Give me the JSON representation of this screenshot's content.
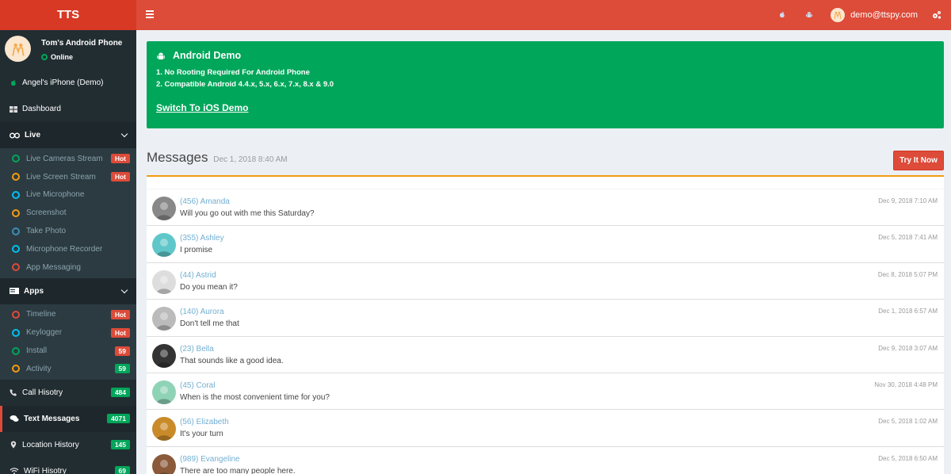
{
  "header": {
    "logo": "TTS",
    "user_email": "demo@ttspy.com",
    "icons": [
      "apple-icon",
      "android-icon",
      "cogs-icon"
    ]
  },
  "sidebar": {
    "device_name": "Tom's Android Phone",
    "device_status": "Online",
    "other_device": "Angel's iPhone (Demo)",
    "dashboard": "Dashboard",
    "live": {
      "label": "Live",
      "items": [
        {
          "label": "Live Cameras Stream",
          "color": "#00a65a",
          "badge": "Hot",
          "badge_color": "red"
        },
        {
          "label": "Live Screen Stream",
          "color": "#f39c12",
          "badge": "Hot",
          "badge_color": "red"
        },
        {
          "label": "Live Microphone",
          "color": "#00c0ef",
          "badge": null
        },
        {
          "label": "Screenshot",
          "color": "#f39c12",
          "badge": null
        },
        {
          "label": "Take Photo",
          "color": "#3c8dbc",
          "badge": null
        },
        {
          "label": "Microphone Recorder",
          "color": "#00c0ef",
          "badge": null
        },
        {
          "label": "App Messaging",
          "color": "#dd4b39",
          "badge": null
        }
      ]
    },
    "apps": {
      "label": "Apps",
      "items": [
        {
          "label": "Timeline",
          "color": "#dd4b39",
          "badge": "Hot",
          "badge_color": "red"
        },
        {
          "label": "Keylogger",
          "color": "#00c0ef",
          "badge": "Hot",
          "badge_color": "red"
        },
        {
          "label": "Install",
          "color": "#00a65a",
          "badge": "59",
          "badge_color": "red"
        },
        {
          "label": "Activity",
          "color": "#f39c12",
          "badge": "59",
          "badge_color": "green"
        }
      ]
    },
    "call_history": {
      "label": "Call Hisotry",
      "badge": "484"
    },
    "text_messages": {
      "label": "Text Messages",
      "badge": "4071"
    },
    "location_history": {
      "label": "Location History",
      "badge": "145"
    },
    "wifi_history": {
      "label": "WiFi Hisotry",
      "badge": "69"
    }
  },
  "demo": {
    "title": "Android Demo",
    "line1": "1. No Rooting Required For Android Phone",
    "line2": "2. Compatible Android 4.4.x, 5.x, 6.x, 7.x, 8.x & 9.0",
    "link": "Switch To iOS Demo"
  },
  "messages": {
    "title": "Messages",
    "subtitle": "Dec 1, 2018 8:40 AM",
    "try_button": "Try It Now",
    "list": [
      {
        "name": "(456) Amanda",
        "text": "Will you go out with me this Saturday?",
        "time": "Dec 9, 2018 7:10 AM",
        "avatar_color": "#888"
      },
      {
        "name": "(355) Ashley",
        "text": "I promise",
        "time": "Dec 5, 2018 7:41 AM",
        "avatar_color": "#5fc7c9"
      },
      {
        "name": "(44) Astrid",
        "text": "Do you mean it?",
        "time": "Dec 8, 2018 5:07 PM",
        "avatar_color": "#ddd"
      },
      {
        "name": "(140) Aurora",
        "text": "Don't tell me that",
        "time": "Dec 1, 2018 6:57 AM",
        "avatar_color": "#bbb"
      },
      {
        "name": "(23) Bella",
        "text": "That sounds like a good idea.",
        "time": "Dec 9, 2018 3:07 AM",
        "avatar_color": "#333"
      },
      {
        "name": "(45) Coral",
        "text": "When is the most convenient time for you?",
        "time": "Nov 30, 2018 4:48 PM",
        "avatar_color": "#8fd3b6"
      },
      {
        "name": "(56) Elizabeth",
        "text": "It's your turn",
        "time": "Dec 5, 2018 1:02 AM",
        "avatar_color": "#c98a2a"
      },
      {
        "name": "(989) Evangeline",
        "text": "There are too many people here.",
        "time": "Dec 5, 2018 6:50 AM",
        "avatar_color": "#8a5a3a"
      }
    ]
  }
}
